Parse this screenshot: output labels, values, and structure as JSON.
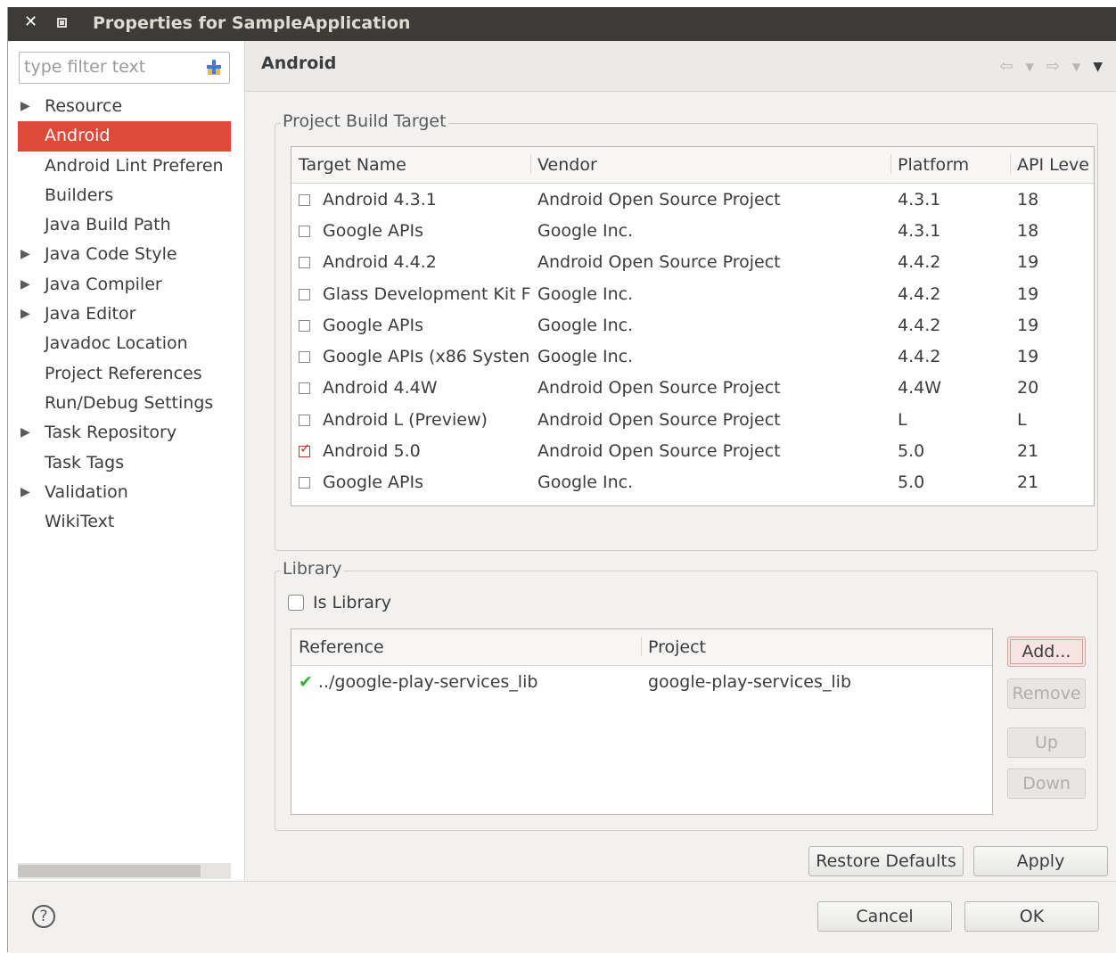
{
  "window": {
    "title": "Properties for SampleApplication"
  },
  "filter": {
    "placeholder": "type filter text"
  },
  "tree": [
    {
      "label": "Resource",
      "expandable": true
    },
    {
      "label": "Android",
      "expandable": false,
      "selected": true
    },
    {
      "label": "Android Lint Preferen",
      "expandable": false
    },
    {
      "label": "Builders",
      "expandable": false
    },
    {
      "label": "Java Build Path",
      "expandable": false
    },
    {
      "label": "Java Code Style",
      "expandable": true
    },
    {
      "label": "Java Compiler",
      "expandable": true
    },
    {
      "label": "Java Editor",
      "expandable": true
    },
    {
      "label": "Javadoc Location",
      "expandable": false
    },
    {
      "label": "Project References",
      "expandable": false
    },
    {
      "label": "Run/Debug Settings",
      "expandable": false
    },
    {
      "label": "Task Repository",
      "expandable": true
    },
    {
      "label": "Task Tags",
      "expandable": false
    },
    {
      "label": "Validation",
      "expandable": true
    },
    {
      "label": "WikiText",
      "expandable": false
    }
  ],
  "page": {
    "title": "Android"
  },
  "build_target": {
    "group_label": "Project Build Target",
    "columns": [
      "Target Name",
      "Vendor",
      "Platform",
      "API Leve"
    ],
    "rows": [
      {
        "name": "Android 4.3.1",
        "vendor": "Android Open Source Project",
        "platform": "4.3.1",
        "api": "18",
        "checked": false
      },
      {
        "name": "Google APIs",
        "vendor": "Google Inc.",
        "platform": "4.3.1",
        "api": "18",
        "checked": false
      },
      {
        "name": "Android 4.4.2",
        "vendor": "Android Open Source Project",
        "platform": "4.4.2",
        "api": "19",
        "checked": false
      },
      {
        "name": "Glass Development Kit F",
        "vendor": "Google Inc.",
        "platform": "4.4.2",
        "api": "19",
        "checked": false
      },
      {
        "name": "Google APIs",
        "vendor": "Google Inc.",
        "platform": "4.4.2",
        "api": "19",
        "checked": false
      },
      {
        "name": "Google APIs (x86 Systen",
        "vendor": "Google Inc.",
        "platform": "4.4.2",
        "api": "19",
        "checked": false
      },
      {
        "name": "Android 4.4W",
        "vendor": "Android Open Source Project",
        "platform": "4.4W",
        "api": "20",
        "checked": false
      },
      {
        "name": "Android L (Preview)",
        "vendor": "Android Open Source Project",
        "platform": "L",
        "api": "L",
        "checked": false
      },
      {
        "name": "Android 5.0",
        "vendor": "Android Open Source Project",
        "platform": "5.0",
        "api": "21",
        "checked": true
      },
      {
        "name": "Google APIs",
        "vendor": "Google Inc.",
        "platform": "5.0",
        "api": "21",
        "checked": false
      }
    ]
  },
  "library": {
    "group_label": "Library",
    "is_library_label": "Is Library",
    "is_library": false,
    "columns": [
      "Reference",
      "Project"
    ],
    "rows": [
      {
        "reference": "../google-play-services_lib",
        "project": "google-play-services_lib",
        "status_icon": "check-icon"
      }
    ],
    "buttons": {
      "add": "Add...",
      "remove": "Remove",
      "up": "Up",
      "down": "Down"
    }
  },
  "actions": {
    "restore_defaults": "Restore Defaults",
    "apply": "Apply"
  },
  "footer": {
    "help_icon": "?",
    "cancel": "Cancel",
    "ok": "OK"
  },
  "colors": {
    "selection": "#dd4a37",
    "titlebar": "#3c3b37",
    "check_ok": "#2fb52f"
  }
}
